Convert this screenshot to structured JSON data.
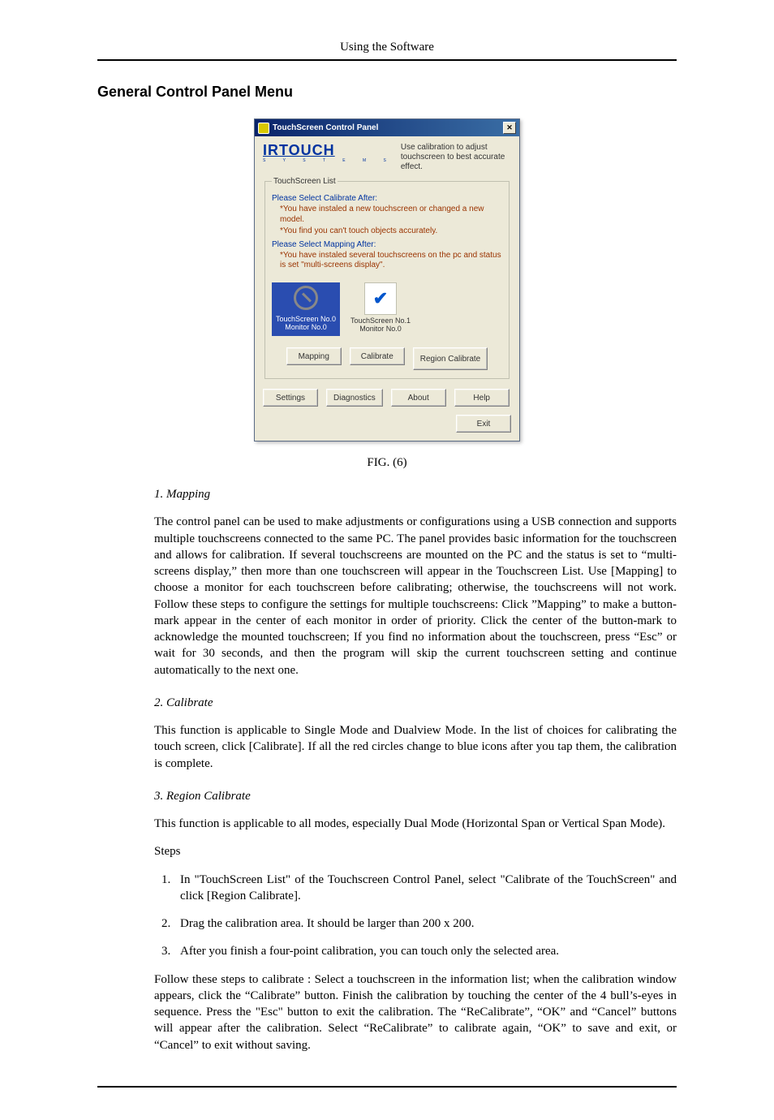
{
  "running_header": "Using the Software",
  "section_title": "General Control Panel Menu",
  "fig_caption": "FIG. (6)",
  "dialog": {
    "title": "TouchScreen Control Panel",
    "brand": "IRTOUCH",
    "brand_sub": "S Y S T E M S",
    "headline": "Use calibration to adjust touchscreen to best accurate effect.",
    "fieldset_title": "TouchScreen List",
    "prompt_calibrate": "Please Select Calibrate After:",
    "note1": "*You have instaled a new touchscreen or changed a new model.",
    "note2": "*You find you can't touch objects accurately.",
    "prompt_mapping": "Please Select Mapping After:",
    "note3": "*You have instaled several touchscreens on the pc and status is set \"multi-screens display\".",
    "thumb0_line1": "TouchScreen No.0",
    "thumb0_line2": "Monitor    No.0",
    "thumb1_line1": "TouchScreen No.1",
    "thumb1_line2": "Monitor    No.0",
    "btn_mapping": "Mapping",
    "btn_calibrate": "Calibrate",
    "btn_region": "Region Calibrate",
    "btn_settings": "Settings",
    "btn_diagnostics": "Diagnostics",
    "btn_about": "About",
    "btn_help": "Help",
    "btn_exit": "Exit"
  },
  "sub1": "1. Mapping",
  "para1": "The control panel can be used to make adjustments or configurations using a USB connection and supports multiple touchscreens connected to the same PC. The panel provides basic information for the touchscreen and allows for calibration. If several touchscreens are mounted on the PC and the status is set to “multi-screens display,” then more than one touchscreen will appear in the Touchscreen List. Use [Mapping] to choose a monitor for each touchscreen before calibrating; otherwise, the touchscreens will not work. Follow these steps to configure the settings for multiple touchscreens: Click ”Mapping” to make a button-mark appear in the center of each monitor in order of priority. Click the center of the button-mark to acknowledge the mounted touchscreen; If you find no information about the touchscreen, press “Esc” or wait for 30 seconds, and then the program will skip the current touchscreen setting and continue automatically to the next one.",
  "sub2": "2. Calibrate",
  "para2": "This function is applicable to Single Mode and Dualview Mode. In the list of choices for calibrating the touch screen, click [Calibrate]. If all the red circles change to blue icons after you tap them, the calibration is complete.",
  "sub3": "3. Region Calibrate",
  "para3": "This function is applicable to all modes, especially Dual Mode (Horizontal Span or Vertical Span Mode).",
  "steps_label": "Steps",
  "steps": {
    "1": "In \"TouchScreen List\" of the Touchscreen Control Panel, select \"Calibrate of the TouchScreen\" and click [Region Calibrate].",
    "2": "Drag the calibration area. It should be larger than 200 x 200.",
    "3": "After you finish a four-point calibration, you can touch only the selected area."
  },
  "para4": "Follow these steps to calibrate : Select a touchscreen in the information list; when the calibration window appears, click the “Calibrate” button. Finish the calibration by touching the center of the 4 bull’s-eyes in sequence. Press the \"Esc\" button to exit the calibration. The “ReCalibrate”, “OK” and “Cancel” buttons will appear after the calibration. Select “ReCalibrate” to calibrate again, “OK” to save and exit, or “Cancel” to exit without saving."
}
